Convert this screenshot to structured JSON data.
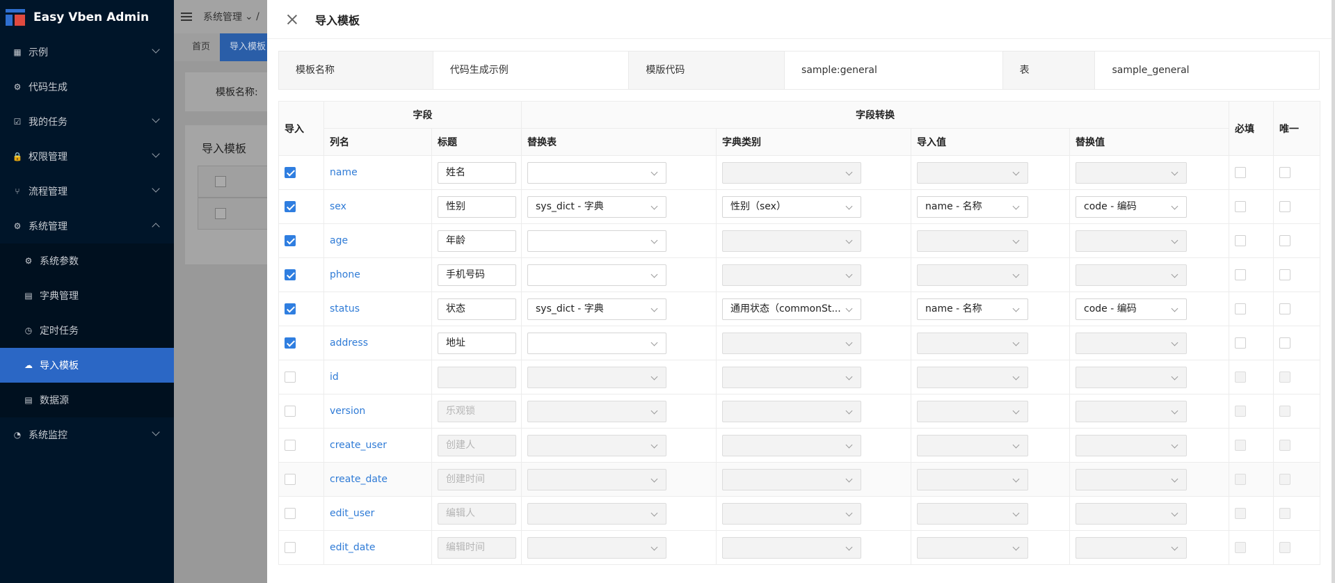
{
  "app": {
    "title": "Easy Vben Admin"
  },
  "sidebar": {
    "items": [
      {
        "label": "示例",
        "icon": "grid-icon",
        "glyph": "▦",
        "expandable": true
      },
      {
        "label": "代码生成",
        "icon": "settings-icon",
        "glyph": "⚙",
        "expandable": false
      },
      {
        "label": "我的任务",
        "icon": "task-icon",
        "glyph": "☑",
        "expandable": true
      },
      {
        "label": "权限管理",
        "icon": "lock-icon",
        "glyph": "🔒",
        "expandable": true
      },
      {
        "label": "流程管理",
        "icon": "branch-icon",
        "glyph": "⑂",
        "expandable": true
      },
      {
        "label": "系统管理",
        "icon": "gear-icon",
        "glyph": "⚙",
        "expandable": true,
        "expanded": true
      },
      {
        "label": "系统参数",
        "icon": "settings-icon",
        "glyph": "⚙",
        "sub": true
      },
      {
        "label": "字典管理",
        "icon": "book-icon",
        "glyph": "▤",
        "sub": true
      },
      {
        "label": "定时任务",
        "icon": "clock-icon",
        "glyph": "◷",
        "sub": true
      },
      {
        "label": "导入模板",
        "icon": "upload-icon",
        "glyph": "☁",
        "sub": true,
        "active": true
      },
      {
        "label": "数据源",
        "icon": "database-icon",
        "glyph": "▤",
        "sub": true
      },
      {
        "label": "系统监控",
        "icon": "dashboard-icon",
        "glyph": "◔",
        "expandable": true
      }
    ]
  },
  "background": {
    "breadcrumb": "系统管理",
    "tabs": [
      "首页",
      "导入模板"
    ],
    "search_label": "模板名称:",
    "card_title": "导入模板"
  },
  "drawer": {
    "title": "导入模板",
    "info": [
      {
        "key": "模板名称",
        "value": "代码生成示例"
      },
      {
        "key": "模版代码",
        "value": "sample:general"
      },
      {
        "key": "表",
        "value": "sample_general"
      }
    ],
    "headers": {
      "import": "导入",
      "field_group": "字段",
      "convert_group": "字段转换",
      "required": "必填",
      "unique": "唯一",
      "column": "列名",
      "caption": "标题",
      "replace_table": "替换表",
      "dict_type": "字典类别",
      "import_value": "导入值",
      "replace_value": "替换值"
    },
    "rows": [
      {
        "import": true,
        "column": "name",
        "caption": "姓名",
        "caption_disabled": false,
        "replace_table": "",
        "dict_type": "",
        "import_value": "",
        "replace_value": ""
      },
      {
        "import": true,
        "column": "sex",
        "caption": "性别",
        "caption_disabled": false,
        "replace_table": "sys_dict - 字典",
        "dict_type": "性别（sex）",
        "import_value": "name - 名称",
        "replace_value": "code - 编码"
      },
      {
        "import": true,
        "column": "age",
        "caption": "年龄",
        "caption_disabled": false,
        "replace_table": "",
        "dict_type": "",
        "import_value": "",
        "replace_value": ""
      },
      {
        "import": true,
        "column": "phone",
        "caption": "手机号码",
        "caption_disabled": false,
        "replace_table": "",
        "dict_type": "",
        "import_value": "",
        "replace_value": ""
      },
      {
        "import": true,
        "column": "status",
        "caption": "状态",
        "caption_disabled": false,
        "replace_table": "sys_dict - 字典",
        "dict_type": "通用状态（commonSt...",
        "import_value": "name - 名称",
        "replace_value": "code - 编码"
      },
      {
        "import": true,
        "column": "address",
        "caption": "地址",
        "caption_disabled": false,
        "replace_table": "",
        "dict_type": "",
        "import_value": "",
        "replace_value": ""
      },
      {
        "import": false,
        "column": "id",
        "caption": "",
        "caption_disabled": true,
        "replace_table": "",
        "dict_type": "",
        "import_value": "",
        "replace_value": ""
      },
      {
        "import": false,
        "column": "version",
        "caption": "乐观锁",
        "caption_disabled": true,
        "replace_table": "",
        "dict_type": "",
        "import_value": "",
        "replace_value": ""
      },
      {
        "import": false,
        "column": "create_user",
        "caption": "创建人",
        "caption_disabled": true,
        "replace_table": "",
        "dict_type": "",
        "import_value": "",
        "replace_value": ""
      },
      {
        "import": false,
        "column": "create_date",
        "caption": "创建时间",
        "caption_disabled": true,
        "replace_table": "",
        "dict_type": "",
        "import_value": "",
        "replace_value": ""
      },
      {
        "import": false,
        "column": "edit_user",
        "caption": "编辑人",
        "caption_disabled": true,
        "replace_table": "",
        "dict_type": "",
        "import_value": "",
        "replace_value": ""
      },
      {
        "import": false,
        "column": "edit_date",
        "caption": "编辑时间",
        "caption_disabled": true,
        "replace_table": "",
        "dict_type": "",
        "import_value": "",
        "replace_value": ""
      }
    ]
  }
}
